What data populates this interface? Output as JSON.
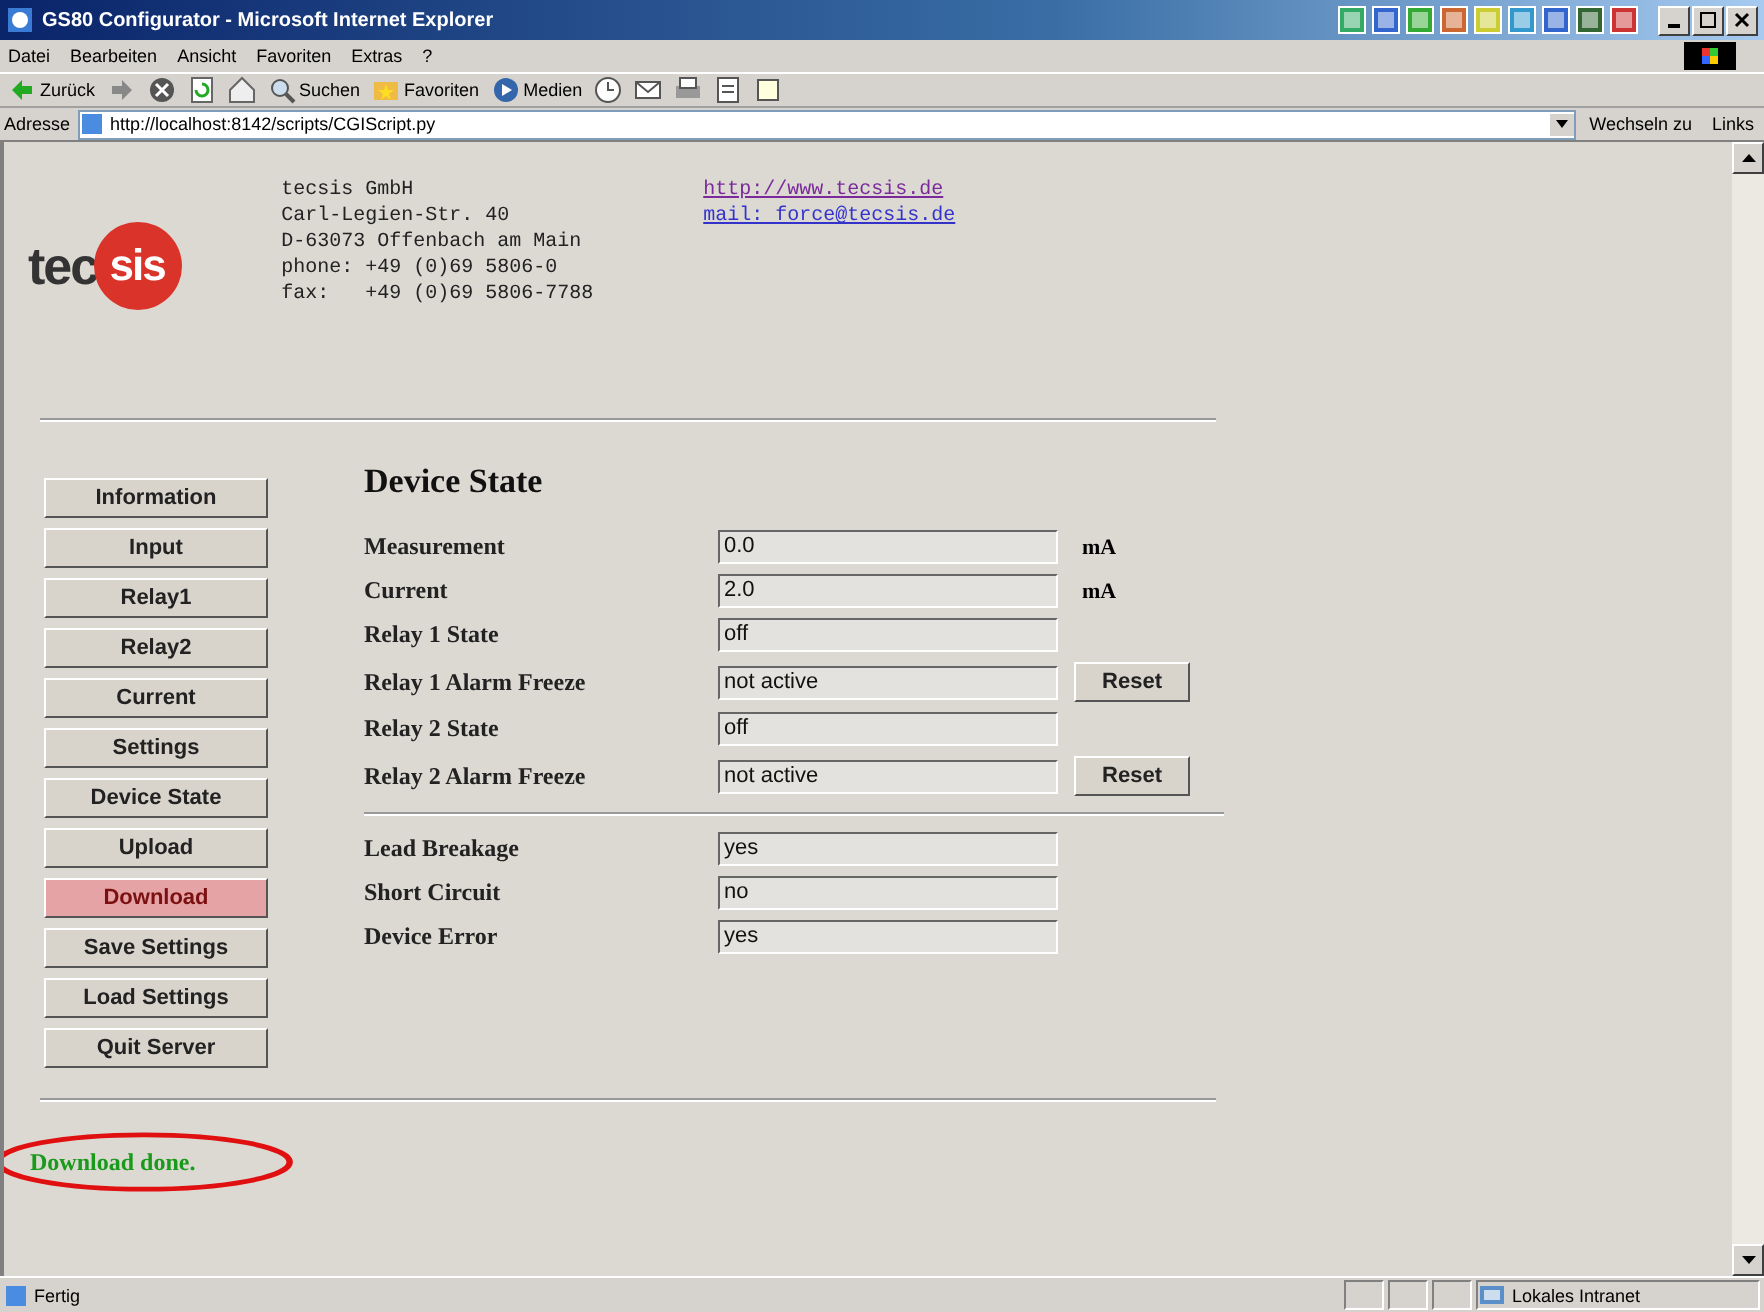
{
  "window": {
    "title": "GS80 Configurator - Microsoft Internet Explorer"
  },
  "menu": [
    "Datei",
    "Bearbeiten",
    "Ansicht",
    "Favoriten",
    "Extras",
    "?"
  ],
  "toolbar": {
    "back": "Zurück",
    "search": "Suchen",
    "favorites": "Favoriten",
    "media": "Medien"
  },
  "address_bar": {
    "label": "Adresse",
    "value": "http://localhost:8142/scripts/CGIScript.py",
    "go": "Wechseln zu",
    "links": "Links"
  },
  "company": {
    "lines": [
      "tecsis GmbH",
      "Carl-Legien-Str. 40",
      "D-63073 Offenbach am Main",
      "phone: +49 (0)69 5806-0",
      "fax:   +49 (0)69 5806-7788"
    ],
    "links": [
      "http://www.tecsis.de",
      "mail: force@tecsis.de"
    ],
    "logo": {
      "left": "tec",
      "right": "sis"
    }
  },
  "nav": [
    {
      "label": "Information",
      "selected": false
    },
    {
      "label": "Input",
      "selected": false
    },
    {
      "label": "Relay1",
      "selected": false
    },
    {
      "label": "Relay2",
      "selected": false
    },
    {
      "label": "Current",
      "selected": false
    },
    {
      "label": "Settings",
      "selected": false
    },
    {
      "label": "Device State",
      "selected": false
    },
    {
      "label": "Upload",
      "selected": false
    },
    {
      "label": "Download",
      "selected": true
    },
    {
      "label": "Save Settings",
      "selected": false
    },
    {
      "label": "Load Settings",
      "selected": false
    },
    {
      "label": "Quit Server",
      "selected": false
    }
  ],
  "heading": "Device State",
  "groups": [
    [
      {
        "label": "Measurement",
        "value": "0.0",
        "unit": "mA"
      },
      {
        "label": "Current",
        "value": "2.0",
        "unit": "mA"
      },
      {
        "label": "Relay 1 State",
        "value": "off"
      },
      {
        "label": "Relay 1 Alarm Freeze",
        "value": "not active",
        "button": "Reset"
      },
      {
        "label": "Relay 2 State",
        "value": "off"
      },
      {
        "label": "Relay 2 Alarm Freeze",
        "value": "not active",
        "button": "Reset"
      }
    ],
    [
      {
        "label": "Lead Breakage",
        "value": "yes"
      },
      {
        "label": "Short Circuit",
        "value": "no"
      },
      {
        "label": "Device Error",
        "value": "yes"
      }
    ]
  ],
  "message": "Download done.",
  "status_bar": {
    "text": "Fertig",
    "zone": "Lokales Intranet"
  }
}
